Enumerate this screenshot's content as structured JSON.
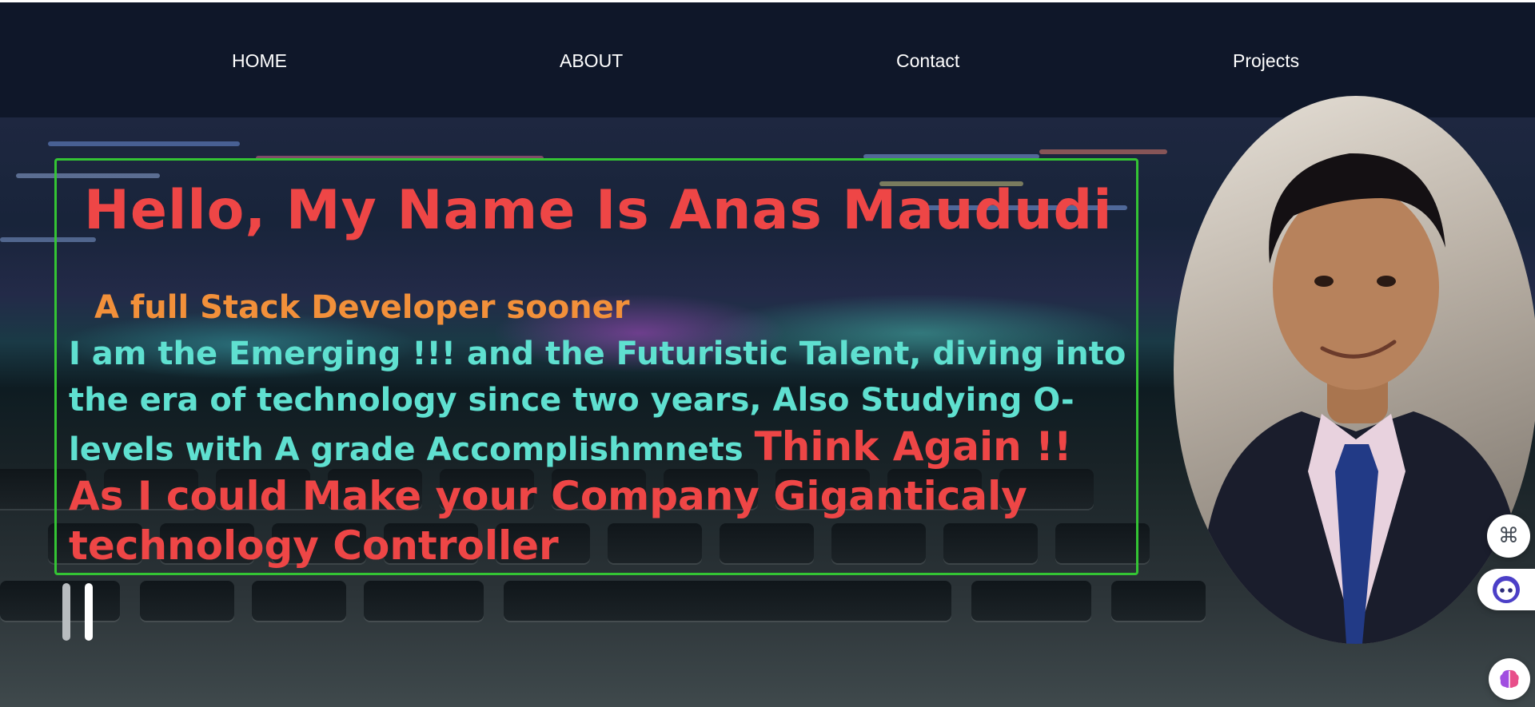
{
  "nav": {
    "items": [
      {
        "label": "HOME"
      },
      {
        "label": "ABOUT"
      },
      {
        "label": "Contact"
      },
      {
        "label": "Projects"
      }
    ]
  },
  "hero": {
    "greeting": "Hello, My Name Is Anas Maududi",
    "subtitle": "A full Stack Developer sooner",
    "bio": "I am the Emerging !!! and the Futuristic Talent, diving into the era of technology since two years, Also Studying O-levels with A grade Accomplishmnets",
    "pitch": "Think Again !! As I could Make your Company Giganticaly technology Controller"
  },
  "photo": {
    "alt": "Portrait of Anas Maududi"
  },
  "floating_buttons": [
    {
      "icon": "command-icon"
    },
    {
      "icon": "assistant-face-icon"
    },
    {
      "icon": "brain-icon"
    }
  ],
  "colors": {
    "nav_bg": "#0f1729",
    "greeting": "#ee4646",
    "subtitle": "#f2903a",
    "bio": "#5fe0d0",
    "card_border": "#34c434"
  }
}
